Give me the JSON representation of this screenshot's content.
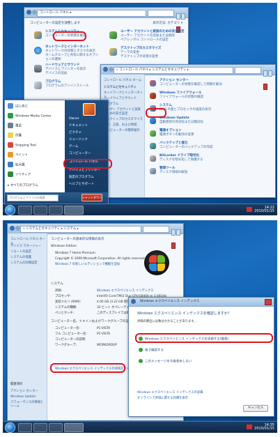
{
  "screenshot_top": {
    "control_panel": {
      "address": "コントロール パネル ▸",
      "heading": "コンピューターの設定を調整します",
      "view_by": "表示方法: カテゴリ ▾",
      "categories_left": [
        {
          "title": "システムとセキュリティ",
          "sub": [
            "コンピューターの状態を確認"
          ]
        },
        {
          "title": "ネットワークとインターネット",
          "sub": [
            "ネットワークの状態とタスクの表示",
            "ホームグループと共有に関するオプションの選択"
          ]
        },
        {
          "title": "ハードウェアとサウンド",
          "sub": [
            "デバイスとプリンターの表示",
            "デバイスの追加"
          ]
        },
        {
          "title": "プログラム",
          "sub": [
            "プログラムのアンインストール"
          ]
        }
      ],
      "categories_right": [
        {
          "title": "ユーザー アカウントと家族のための安全設定",
          "sub": [
            "ユーザー アカウントの追加または削除",
            "ペアレンタル コントロールの設定"
          ]
        },
        {
          "title": "デスクトップのカスタマイズ",
          "sub": [
            "テーマの変更",
            "デスクトップの背景の変更",
            "画面の解像度の調整"
          ]
        },
        {
          "title": "時計、言語、および地域",
          "sub": [
            "キーボードまたは入力方法の変更"
          ]
        },
        {
          "title": "コンピューターの簡単操作",
          "sub": [
            "設定の提案の表示",
            "視覚ディスプレイの最適化"
          ]
        }
      ]
    },
    "system_security": {
      "address": "« コントロール パネル ▸ システムとセキュリティ ▸",
      "sidebar": [
        "コントロール パネル ホーム",
        "システムとセキュリティ",
        "ネットワークとインターネット",
        "ハードウェアとサウンド",
        "プログラム",
        "ユーザー アカウントと家族のための安全設定",
        "デスクトップのカスタマイズ",
        "時計、言語、および地域",
        "コンピューターの簡単操作"
      ],
      "items": [
        {
          "title": "アクション センター",
          "sub": "コンピューターの状態を確認して問題を解決"
        },
        {
          "title": "Windows ファイアウォール",
          "sub": "ファイアウォールの状態の確認"
        },
        {
          "title": "システム",
          "sub": "RAM の量とプロセッサの速度の表示"
        },
        {
          "title": "Windows Update",
          "sub": "自動更新の有効化または無効化"
        },
        {
          "title": "電源オプション",
          "sub": "電源ボタンの動作の変更"
        },
        {
          "title": "バックアップと復元",
          "sub": "コンピューターのバックアップの作成"
        },
        {
          "title": "BitLocker ドライブ暗号化",
          "sub": "ディスクを暗号化して保護する"
        },
        {
          "title": "管理ツール",
          "sub": "ディスク領域の解放"
        }
      ]
    },
    "start_menu": {
      "left_items": [
        "はじめに",
        "Windows Media Center",
        "電卓",
        "付箋",
        "Snipping Tool",
        "ペイント",
        "拡大鏡",
        "ソリティア"
      ],
      "all_programs": "すべてのプログラム",
      "search_placeholder": "プログラムとファイルの検索",
      "right_items": [
        "Owner",
        "ドキュメント",
        "ピクチャ",
        "ミュージック",
        "ゲーム",
        "コンピューター",
        "コントロール パネル",
        "デバイスとプリンター",
        "既定のプログラム",
        "ヘルプとサポート"
      ],
      "shutdown": "シャットダウン ▸"
    },
    "tray": {
      "time": "14:22",
      "date": "2010/01/15"
    }
  },
  "screenshot_bottom": {
    "system_window": {
      "address": "« システムとセキュリティ ▸ システム ▸",
      "sidebar": [
        "コントロール パネル ホーム",
        "デバイス マネージャー",
        "リモートの設定",
        "システムの保護",
        "システムの詳細設定"
      ],
      "see_also": [
        "関連項目",
        "アクション センター",
        "Windows Update",
        "パフォーマンスの情報とツール"
      ],
      "heading": "コンピューターの基本的な情報の表示",
      "edition_label": "Windows Edition",
      "edition_lines": [
        "Windows 7 Home Premium",
        "Copyright © 2009 Microsoft Corporation. All rights reserved.",
        "Windows 7 の新しいエディションで機能を追加"
      ],
      "system_label": "システム",
      "system_rows": [
        {
          "k": "評価:",
          "v": "Windows エクスペリエンス インデックス"
        },
        {
          "k": "プロセッサ:",
          "v": "Intel(R) Core(TM)2 Duo CPU  E8400 @ 3.00GHz"
        },
        {
          "k": "実装メモリ (RAM):",
          "v": "4.00 GB (3.22 GB 使用可能)"
        },
        {
          "k": "システムの種類:",
          "v": "32 ビット オペレーティング システム"
        },
        {
          "k": "ペンとタッチ:",
          "v": "このディスプレイでは利用できません"
        }
      ],
      "computer_label": "コンピューター名、ドメインおよびワークグループの設定",
      "computer_rows": [
        {
          "k": "コンピューター名:",
          "v": "PC-VISTA"
        },
        {
          "k": "フル コンピューター名:",
          "v": "PC-VISTA"
        },
        {
          "k": "コンピューターの説明:",
          "v": ""
        },
        {
          "k": "ワークグループ:",
          "v": "WORKGROUP"
        }
      ],
      "change_settings": "設定の変更",
      "highlighted_link": "Windows エクスペリエンス インデックスの評価をする"
    },
    "dialog": {
      "title": "Windows エクスペリエンス インデックス",
      "heading": "Windows エクスペリエンス インデックスを確認しますか?",
      "body": "評価の算出には数分かかることがあります。",
      "options": [
        "Windows エクスペリエンス インデックスを評価する(推奨)",
        "後で確認する",
        "このメッセージを今後表示しない"
      ],
      "links": [
        "Windows エクスペリエンス インデックスの詳細",
        "オンラインで評価に関する詳細を表示"
      ],
      "cancel": "キャンセル"
    },
    "tray": {
      "time": "14:35",
      "date": "2010/01/15"
    }
  }
}
